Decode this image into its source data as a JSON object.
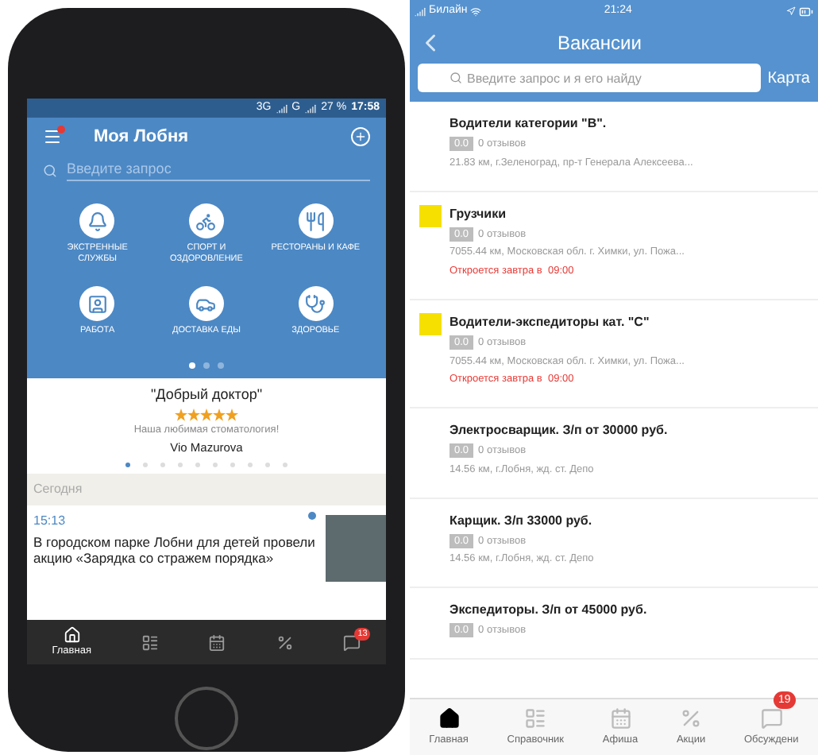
{
  "left_phone": {
    "status_bar": {
      "network": "3G",
      "network_2": "G",
      "battery": "27 %",
      "time": "17:58"
    },
    "header": {
      "title": "Моя Лобня",
      "menu_notification": true
    },
    "search": {
      "placeholder": "Введите запрос"
    },
    "categories": [
      {
        "kind": "bell",
        "label": "ЭКСТРЕННЫЕ СЛУЖБЫ"
      },
      {
        "kind": "bike",
        "label": "СПОРТ И ОЗДОРОВЛЕНИЕ"
      },
      {
        "kind": "food",
        "label": "РЕСТОРАНЫ И КАФЕ"
      },
      {
        "kind": "work",
        "label": "РАБОТА"
      },
      {
        "kind": "delivery",
        "label": "ДОСТАВКА ЕДЫ"
      },
      {
        "kind": "health",
        "label": "ЗДОРОВЬЕ"
      }
    ],
    "category_pages": [
      {
        "selected": true
      },
      {
        "selected": false
      },
      {
        "selected": false
      }
    ],
    "review": {
      "title": "\"Добрый доктор\"",
      "stars": 5,
      "text": "Наша любимая стоматология!",
      "author": "Vio Mazurova",
      "pages": [
        {
          "selected": true
        },
        {
          "selected": false
        },
        {
          "selected": false
        },
        {
          "selected": false
        },
        {
          "selected": false
        },
        {
          "selected": false
        },
        {
          "selected": false
        },
        {
          "selected": false
        },
        {
          "selected": false
        },
        {
          "selected": false
        }
      ]
    },
    "section": "Сегодня",
    "news": {
      "time": "15:13",
      "text": "В городском парке Лобни для детей провели акцию «Зарядка со стражем порядка»",
      "unread": true
    },
    "nav": [
      {
        "kind": "home",
        "label": "Главная",
        "selected": true
      },
      {
        "kind": "list",
        "selected": false
      },
      {
        "kind": "calendar",
        "selected": false
      },
      {
        "kind": "percent",
        "selected": false
      },
      {
        "kind": "chat",
        "selected": false,
        "badge": "13"
      }
    ]
  },
  "right_screen": {
    "status_bar": {
      "carrier": "Билайн",
      "time": "21:24"
    },
    "title": "Вакансии",
    "search": {
      "placeholder": "Введите запрос и я его найду"
    },
    "map_button": "Карта",
    "vacancies": [
      {
        "logo": false,
        "title": "Водители категории \"В\".",
        "rating": "0.0",
        "reviews": "0 отзывов",
        "address": "21.83 км, г.Зеленоград, пр-т Генерала Алексеева..."
      },
      {
        "logo": true,
        "title": "Грузчики",
        "rating": "0.0",
        "reviews": "0 отзывов",
        "address": "7055.44 км, Московская обл. г. Химки, ул. Пожа...",
        "hours": "Откроется завтра в  09:00"
      },
      {
        "logo": true,
        "title": "Водители-экспедиторы кат. \"С\"",
        "rating": "0.0",
        "reviews": "0 отзывов",
        "address": "7055.44 км, Московская обл. г. Химки, ул. Пожа...",
        "hours": "Откроется завтра в  09:00"
      },
      {
        "logo": false,
        "title": "Электросварщик. З/п от 30000 руб.",
        "rating": "0.0",
        "reviews": "0 отзывов",
        "address": "14.56 км, г.Лобня, жд. ст. Депо"
      },
      {
        "logo": false,
        "title": "Карщик. З/п 33000 руб.",
        "rating": "0.0",
        "reviews": "0 отзывов",
        "address": "14.56 км, г.Лобня, жд. ст. Депо"
      },
      {
        "logo": false,
        "title": "Экспедиторы. З/п от 45000 руб.",
        "rating": "0.0",
        "reviews": "0 отзывов"
      }
    ],
    "tabs": [
      {
        "kind": "home",
        "label": "Главная",
        "selected": true
      },
      {
        "kind": "list",
        "label": "Справочник",
        "selected": false
      },
      {
        "kind": "calendar",
        "label": "Афиша",
        "selected": false
      },
      {
        "kind": "percent",
        "label": "Акции",
        "selected": false
      },
      {
        "kind": "chat",
        "label": "Обсуждени",
        "selected": false,
        "badge": "19"
      }
    ]
  }
}
